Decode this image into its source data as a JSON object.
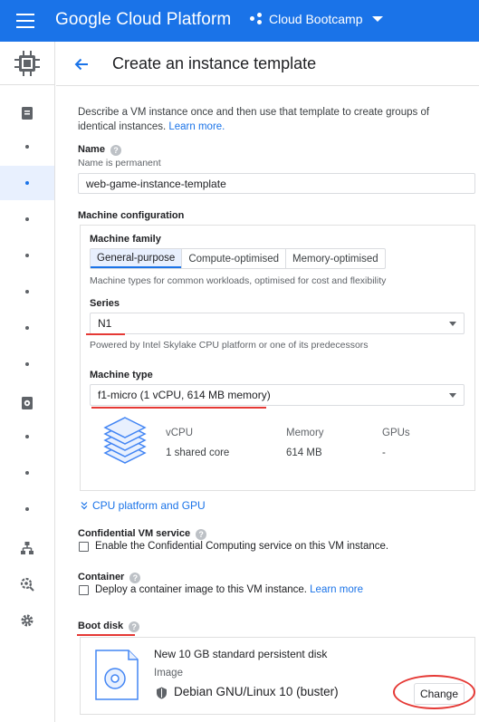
{
  "topbar": {
    "brand": "Google Cloud Platform",
    "project": "Cloud Bootcamp",
    "menu_icon": "hamburger-icon",
    "project_icon": "project-nodes-icon",
    "dropdown_icon": "caret-down-icon"
  },
  "header": {
    "title": "Create an instance template",
    "back_icon": "arrow-back-icon"
  },
  "description": {
    "text": "Describe a VM instance once and then use that template to create groups of identical instances.",
    "link": "Learn more."
  },
  "name": {
    "label": "Name",
    "hint": "Name is permanent",
    "value": "web-game-instance-template"
  },
  "machine_configuration": {
    "label": "Machine configuration",
    "family_label": "Machine family",
    "families": [
      "General-purpose",
      "Compute-optimised",
      "Memory-optimised"
    ],
    "selected_family": "General-purpose",
    "family_hint": "Machine types for common workloads, optimised for cost and flexibility",
    "series_label": "Series",
    "series_value": "N1",
    "series_hint": "Powered by Intel Skylake CPU platform or one of its predecessors",
    "type_label": "Machine type",
    "type_value": "f1-micro (1 vCPU, 614 MB memory)",
    "specs": {
      "headers": [
        "vCPU",
        "Memory",
        "GPUs"
      ],
      "values": [
        "1 shared core",
        "614 MB",
        "-"
      ]
    },
    "cpu_link": "CPU platform and GPU"
  },
  "confidential": {
    "label": "Confidential VM service",
    "checkbox": "Enable the Confidential Computing service on this VM instance."
  },
  "container": {
    "label": "Container",
    "checkbox": "Deploy a container image to this VM instance.",
    "link": "Learn more"
  },
  "boot_disk": {
    "label": "Boot disk",
    "title": "New 10 GB standard persistent disk",
    "image_label": "Image",
    "image_value": "Debian GNU/Linux 10 (buster)",
    "change_button": "Change"
  },
  "help_glyph": "?",
  "colors": {
    "primary": "#1a73e8",
    "annotation_red": "#e53935"
  }
}
